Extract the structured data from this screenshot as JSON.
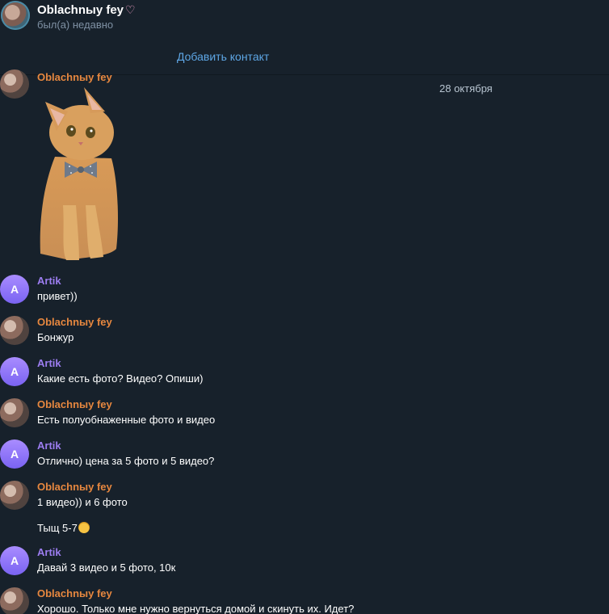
{
  "header": {
    "title": "Oblachnыy fey",
    "status": "был(а) недавно",
    "title_emoji_icon": "pink-heart-icon"
  },
  "add_contact": {
    "label": "Добавить контакт"
  },
  "date_separator": "28 октября",
  "messages": [
    {
      "sender": "Oblachnыy fey",
      "sender_color": "#e6873f",
      "avatar": "photo",
      "sticker": "cat-with-bowtie-sticker"
    },
    {
      "sender": "Artik",
      "sender_color": "#9c7df0",
      "avatar_letter": "A",
      "text": "привет))"
    },
    {
      "sender": "Oblachnыy fey",
      "sender_color": "#e6873f",
      "avatar": "photo",
      "text": "Бонжур"
    },
    {
      "sender": "Artik",
      "sender_color": "#9c7df0",
      "avatar_letter": "A",
      "text": "Какие есть фото? Видео? Опиши)"
    },
    {
      "sender": "Oblachnыy fey",
      "sender_color": "#e6873f",
      "avatar": "photo",
      "text": "Есть полуобнаженные фото и видео"
    },
    {
      "sender": "Artik",
      "sender_color": "#9c7df0",
      "avatar_letter": "A",
      "text": "Отлично) цена за 5 фото и 5 видео?"
    },
    {
      "sender": "Oblachnыy fey",
      "sender_color": "#e6873f",
      "avatar": "photo",
      "text": "1 видео)) и 6 фото",
      "followup": "Тыщ 5-7",
      "followup_icon": "smiling-cat-emoji-icon"
    },
    {
      "sender": "Artik",
      "sender_color": "#9c7df0",
      "avatar_letter": "A",
      "text": "Давай 3 видео и 5 фото, 10к"
    },
    {
      "sender": "Oblachnыy fey",
      "sender_color": "#e6873f",
      "avatar": "photo",
      "text": "Хорошо. Только мне нужно вернуться домой и скинуть их. Идет?"
    }
  ],
  "colors": {
    "background": "#17212b",
    "link": "#5ea7e6",
    "secondary_text": "#7f91a4"
  }
}
